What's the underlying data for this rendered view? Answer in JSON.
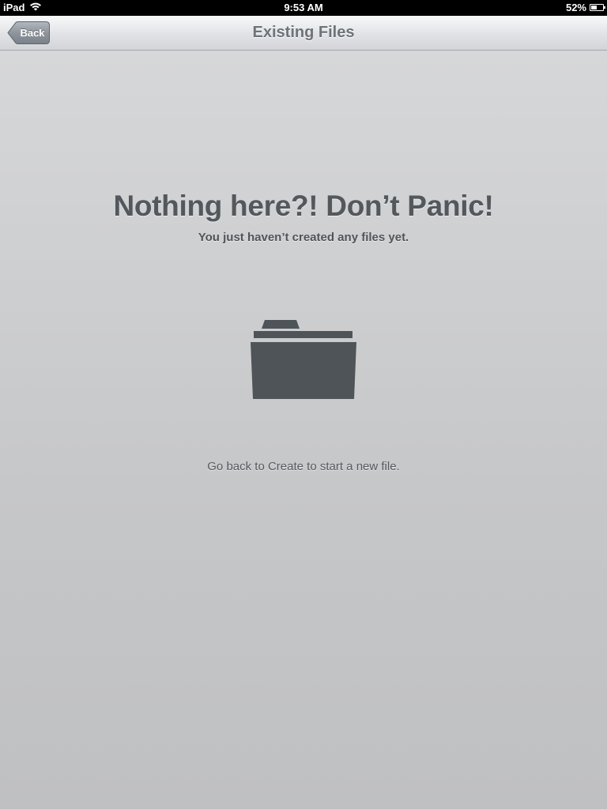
{
  "status_bar": {
    "device": "iPad",
    "time": "9:53 AM",
    "battery_percent": "52%",
    "battery_level": 0.52,
    "wifi_icon": "wifi-icon",
    "battery_icon": "battery-icon"
  },
  "nav": {
    "back_label": "Back",
    "title": "Existing Files"
  },
  "empty_state": {
    "headline": "Nothing here?! Don’t Panic!",
    "subhead": "You just haven’t created any files yet.",
    "icon": "folder-icon",
    "hint": "Go back to Create to start a new file."
  },
  "colors": {
    "icon": "#4f5459",
    "text": "#53585d"
  }
}
